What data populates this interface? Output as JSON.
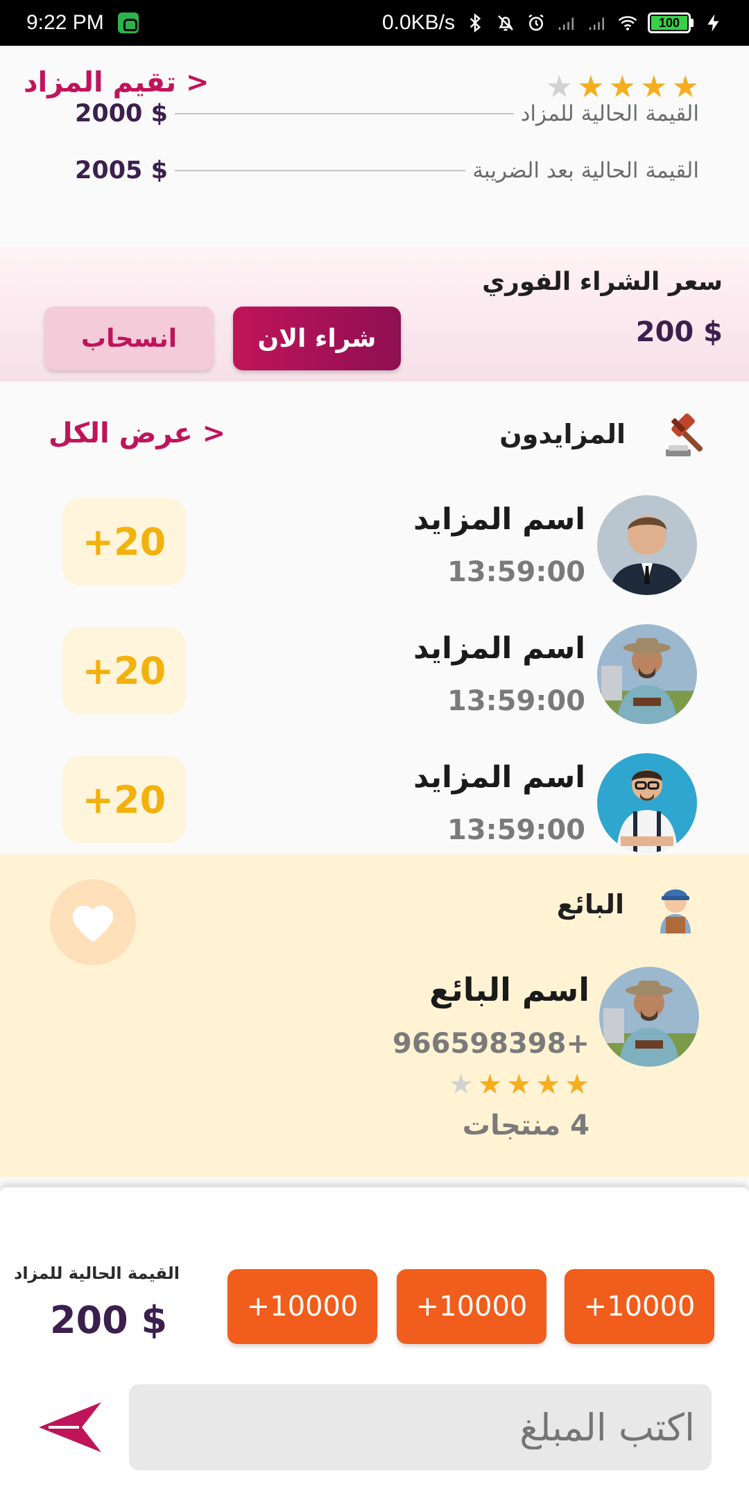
{
  "status_bar": {
    "time": "9:22 PM",
    "net_speed": "0.0KB/s",
    "battery": "100",
    "icons": [
      "bluetooth-icon",
      "mute-icon",
      "alarm-icon",
      "signal-icon",
      "signal-icon",
      "wifi-icon",
      "charging-icon"
    ]
  },
  "auction": {
    "rate_link": "تقيم المزاد >",
    "rating_filled": 4,
    "rating_total": 5,
    "current_value_label": "القيمة الحالية للمزاد",
    "current_value": "2000 $",
    "value_after_tax_label": "القيمة الحالية بعد الضريبة",
    "value_after_tax": "2005 $"
  },
  "instant_buy": {
    "title": "سعر الشراء الفوري",
    "price": "200 $",
    "buy_now_label": "شراء الان",
    "withdraw_label": "انسحاب"
  },
  "bidders": {
    "title": "المزايدون",
    "view_all": "عرض الكل >",
    "items": [
      {
        "name": "اسم المزايد",
        "time": "13:59:00",
        "bid": "+20"
      },
      {
        "name": "اسم المزايد",
        "time": "13:59:00",
        "bid": "+20"
      },
      {
        "name": "اسم المزايد",
        "time": "13:59:00",
        "bid": "+20"
      }
    ]
  },
  "seller": {
    "title": "البائع",
    "name": "اسم البائع",
    "phone": "966598398+",
    "rating_filled": 4,
    "rating_total": 5,
    "products": "4 منتجات"
  },
  "bid_panel": {
    "current_label": "القيمة الحالية للمزاد",
    "current_value": "200 $",
    "increments": [
      "+10000",
      "+10000",
      "+10000"
    ],
    "amount_placeholder": "اكتب المبلغ"
  },
  "colors": {
    "primary": "#c0145a",
    "accent_orange": "#f05d1c",
    "gold": "#f2b10c",
    "dark_purple": "#3b1f4e",
    "seller_bg": "#fff3d4"
  }
}
